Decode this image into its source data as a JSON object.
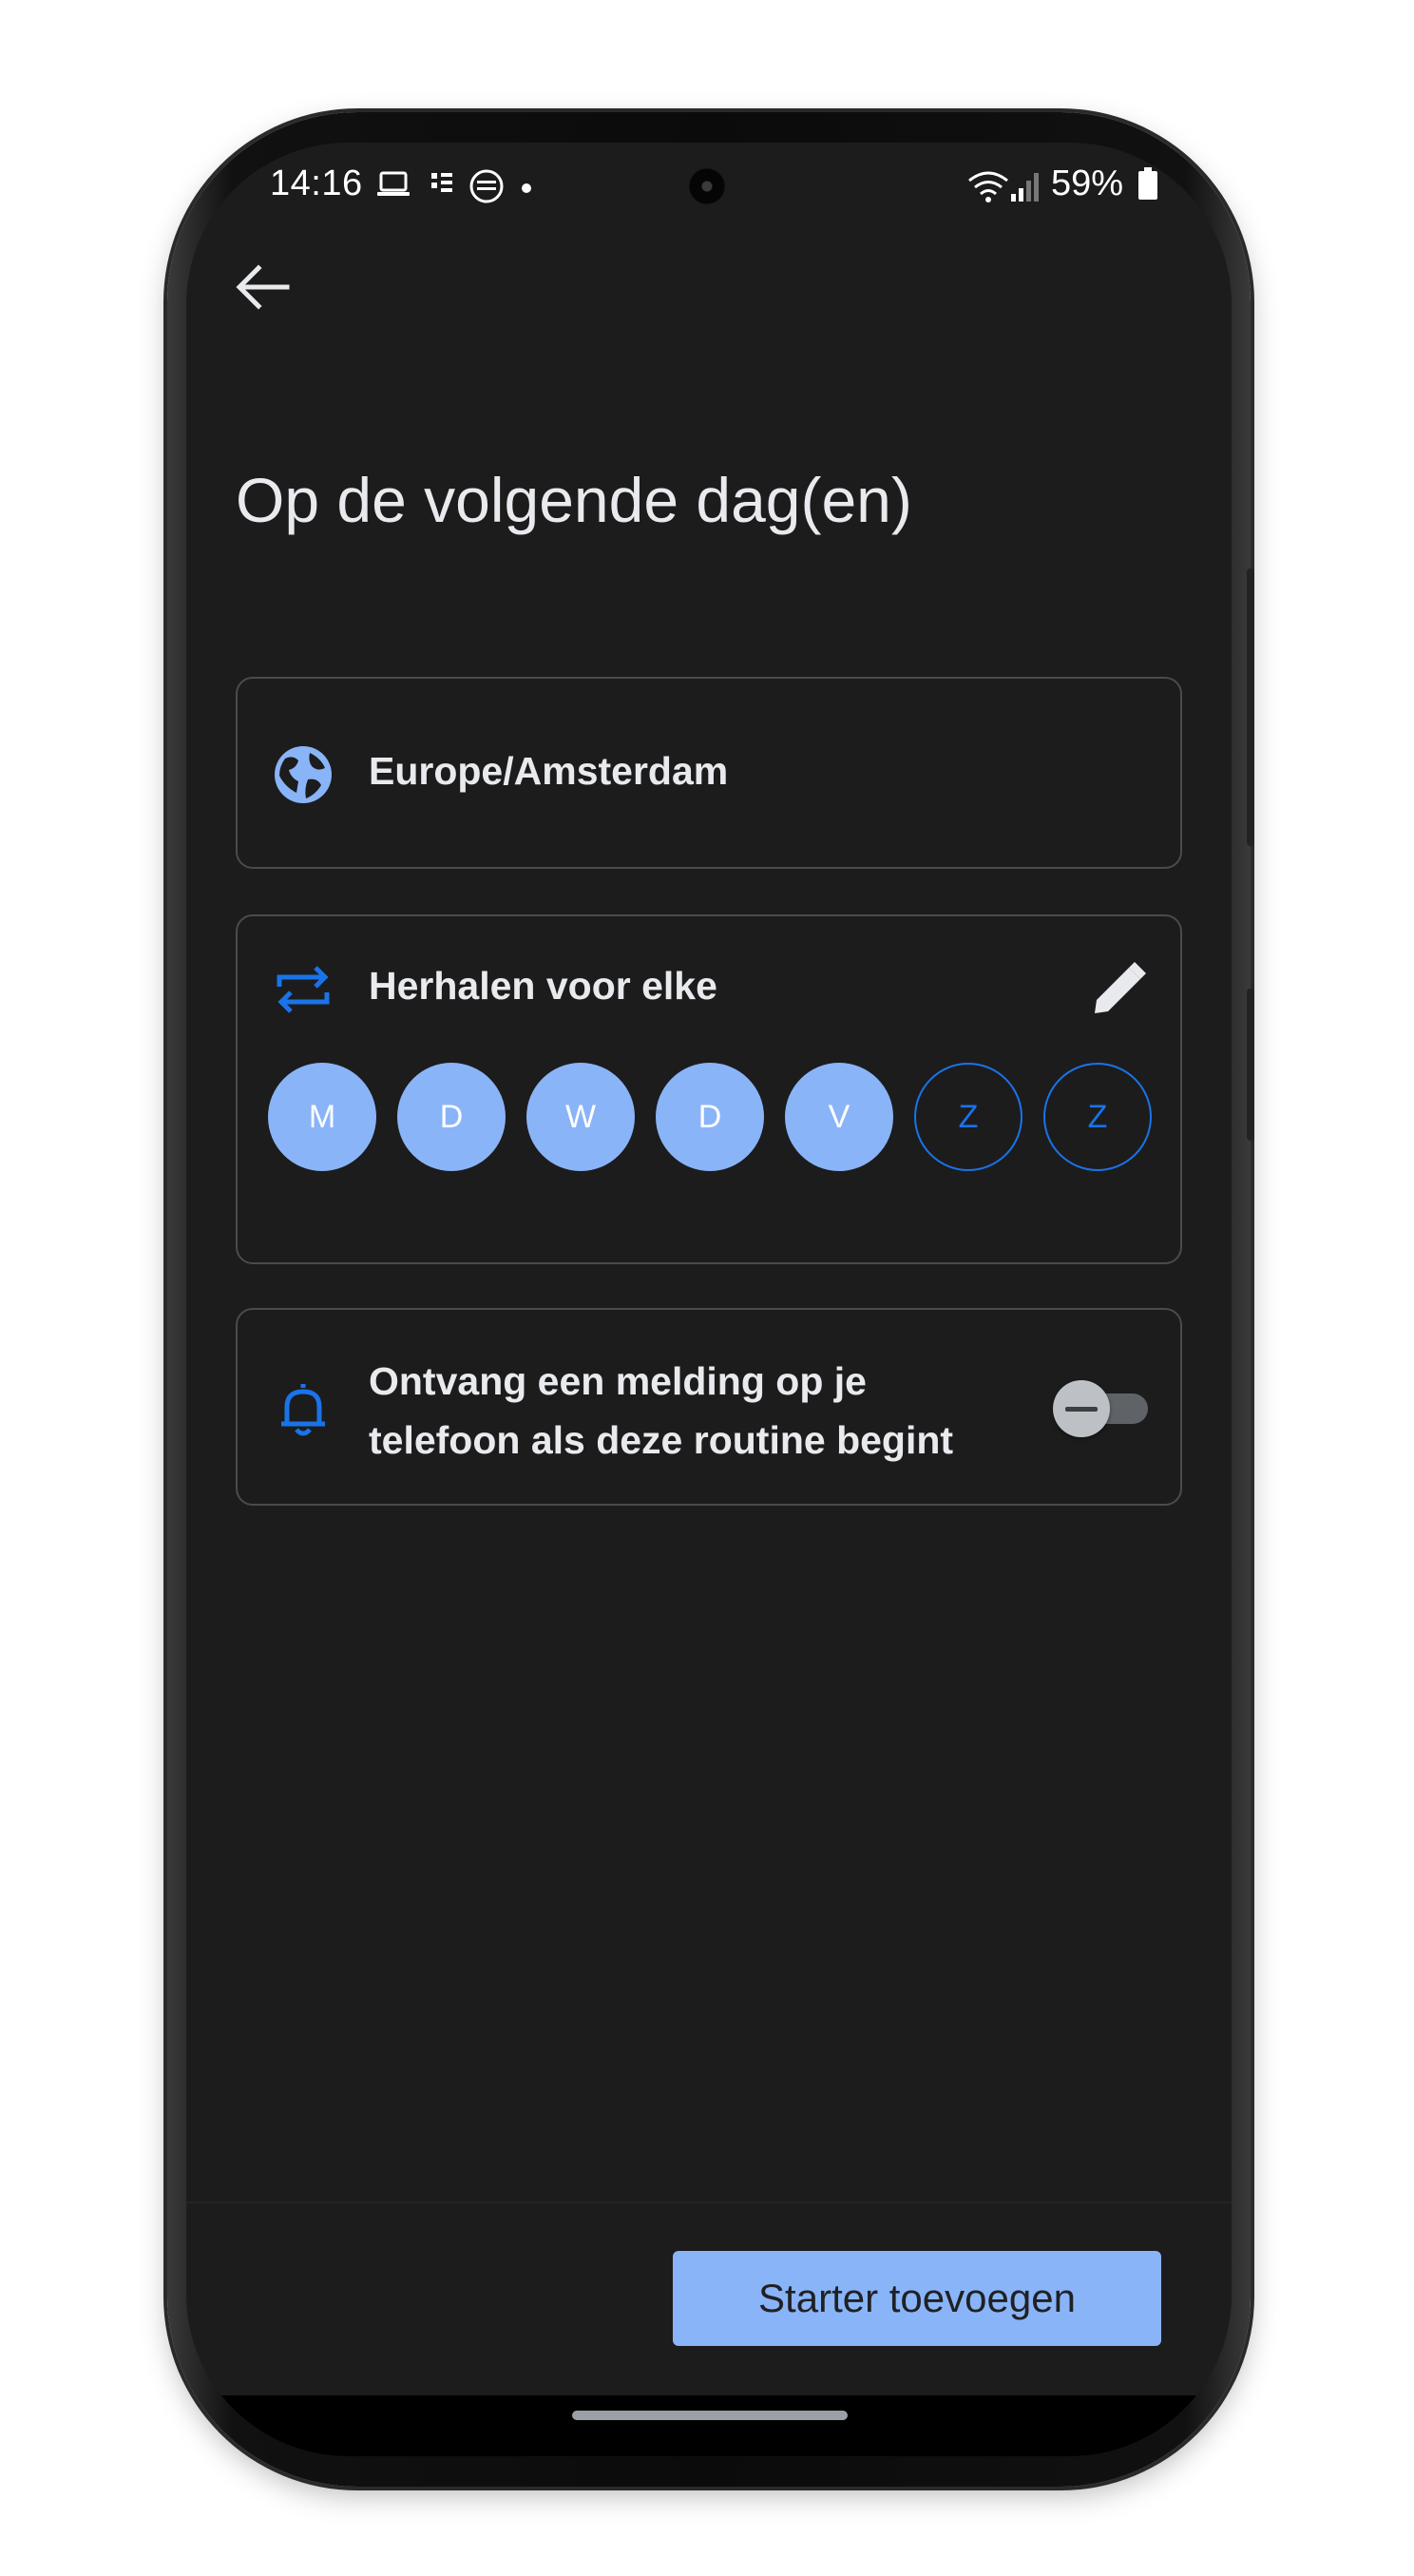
{
  "status_bar": {
    "time": "14:16",
    "battery": "59%"
  },
  "header": {
    "title": "Op de volgende dag(en)"
  },
  "timezone": {
    "label": "Europe/Amsterdam"
  },
  "repeat": {
    "label": "Herhalen voor elke",
    "days": [
      {
        "label": "M",
        "selected": true
      },
      {
        "label": "D",
        "selected": true
      },
      {
        "label": "W",
        "selected": true
      },
      {
        "label": "D",
        "selected": true
      },
      {
        "label": "V",
        "selected": true
      },
      {
        "label": "Z",
        "selected": false
      },
      {
        "label": "Z",
        "selected": false
      }
    ]
  },
  "notification": {
    "line1": "Ontvang een melding op je",
    "line2": "telefoon als deze routine begint",
    "enabled": false
  },
  "footer": {
    "button_label": "Starter toevoegen"
  },
  "colors": {
    "background": "#1c1c1d",
    "accent": "#8ab4f8",
    "accent_strong": "#1a73e8",
    "card_border": "#4a4b4d",
    "text": "#e8eaed"
  },
  "icons": {
    "back": "arrow-left-icon",
    "timezone": "globe-icon",
    "repeat": "repeat-icon",
    "edit": "pencil-icon",
    "notification": "bell-icon"
  }
}
